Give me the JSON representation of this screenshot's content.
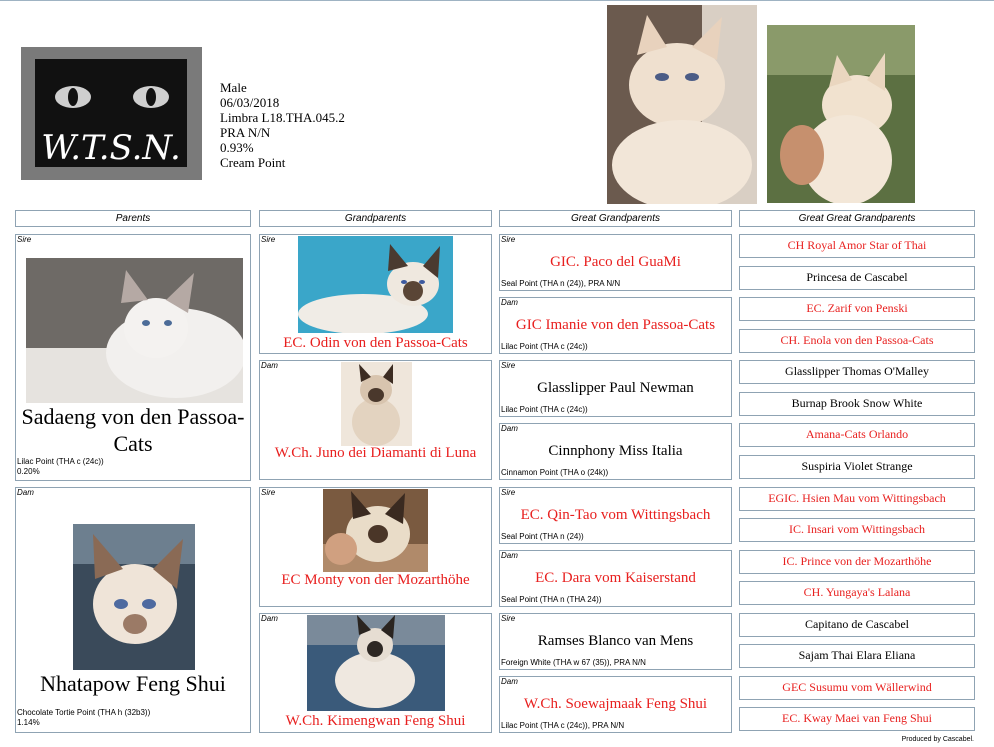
{
  "cat": {
    "logo_text": "W.T.S.N.",
    "sex": "Male",
    "dob": "06/03/2018",
    "registration": "Limbra L18.THA.045.2",
    "pra": "PRA N/N",
    "coi": "0.93%",
    "color": "Cream Point"
  },
  "headers": {
    "parents": "Parents",
    "grandparents": "Grandparents",
    "great": "Great Grandparents",
    "greatgreat": "Great Great Grandparents"
  },
  "parents": [
    {
      "role": "Sire",
      "name": "Sadaeng von den Passoa-Cats",
      "detail": "Lilac Point (THA c (24c))",
      "coi": "0.20%"
    },
    {
      "role": "Dam",
      "name": "Nhatapow Feng Shui",
      "detail": "Chocolate Tortie Point (THA h (32b3))",
      "coi": "1.14%"
    }
  ],
  "grandparents": [
    {
      "role": "Sire",
      "name": "EC. Odin von den Passoa-Cats"
    },
    {
      "role": "Dam",
      "name": "W.Ch. Juno dei Diamanti di Luna"
    },
    {
      "role": "Sire",
      "name": "EC Monty von der Mozarthöhe"
    },
    {
      "role": "Dam",
      "name": "W.Ch. Kimengwan Feng Shui"
    }
  ],
  "great": [
    {
      "role": "Sire",
      "name": "GIC. Paco del GuaMi",
      "detail": "Seal Point (THA n (24)), PRA N/N"
    },
    {
      "role": "Dam",
      "name": "GIC Imanie von den Passoa-Cats",
      "detail": "Lilac Point (THA c (24c))"
    },
    {
      "role": "Sire",
      "name": "Glasslipper Paul Newman",
      "detail": "Lilac Point (THA c (24c))"
    },
    {
      "role": "Dam",
      "name": "Cinnphony Miss Italia",
      "detail": "Cinnamon Point (THA o (24k))"
    },
    {
      "role": "Sire",
      "name": "EC. Qin-Tao vom Wittingsbach",
      "detail": "Seal Point (THA n (24))"
    },
    {
      "role": "Dam",
      "name": "EC. Dara vom Kaiserstand",
      "detail": "Seal Point (THA n (THA 24))"
    },
    {
      "role": "Sire",
      "name": "Ramses Blanco van Mens",
      "detail": "Foreign White (THA w 67 (35)), PRA N/N"
    },
    {
      "role": "Dam",
      "name": "W.Ch. Soewajmaak Feng Shui",
      "detail": "Lilac Point (THA c (24c)), PRA N/N"
    }
  ],
  "greatgreat": [
    {
      "name": "CH Royal Amor Star of Thai",
      "title": true
    },
    {
      "name": "Princesa de Cascabel",
      "title": false
    },
    {
      "name": "EC. Zarif von Penski",
      "title": true
    },
    {
      "name": "CH. Enola von den Passoa-Cats",
      "title": true
    },
    {
      "name": "Glasslipper Thomas O'Malley",
      "title": false
    },
    {
      "name": "Burnap Brook Snow White",
      "title": false
    },
    {
      "name": "Amana-Cats Orlando",
      "title": true
    },
    {
      "name": "Suspiria Violet Strange",
      "title": false
    },
    {
      "name": "EGIC. Hsien Mau vom Wittingsbach",
      "title": true
    },
    {
      "name": "IC. Insari vom Wittingsbach",
      "title": true
    },
    {
      "name": "IC. Prince von der Mozarthöhe",
      "title": true
    },
    {
      "name": "CH. Yungaya's Lalana",
      "title": true
    },
    {
      "name": "Capitano de Cascabel",
      "title": false
    },
    {
      "name": "Sajam Thai Elara Eliana",
      "title": false
    },
    {
      "name": "GEC Susumu vom Wällerwind",
      "title": true
    },
    {
      "name": "EC. Kway Maei van Feng Shui",
      "title": true
    }
  ],
  "footer": "Produced by Cascabel.",
  "colors": {
    "title_red": "#e8201f",
    "border": "#8fa3b3"
  }
}
